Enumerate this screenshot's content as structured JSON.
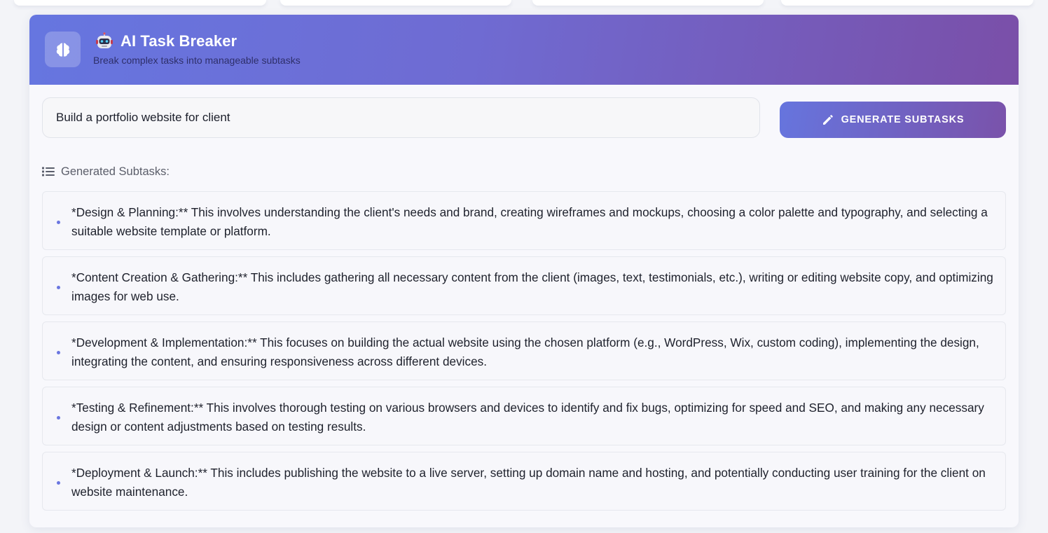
{
  "header": {
    "title": "AI Task Breaker",
    "subtitle": "Break complex tasks into manageable subtasks",
    "gradient": [
      "#6676e0",
      "#7a4fa8"
    ]
  },
  "task_input": {
    "value": "Build a portfolio website for client"
  },
  "generate_button": {
    "label": "GENERATE SUBTASKS",
    "icon": "pencil-icon"
  },
  "results": {
    "label": "Generated Subtasks:",
    "icon": "list-icon",
    "subtasks": [
      "*Design & Planning:** This involves understanding the client's needs and brand, creating wireframes and mockups, choosing a color palette and typography, and selecting a suitable website template or platform.",
      "*Content Creation & Gathering:** This includes gathering all necessary content from the client (images, text, testimonials, etc.), writing or editing website copy, and optimizing images for web use.",
      "*Development & Implementation:** This focuses on building the actual website using the chosen platform (e.g., WordPress, Wix, custom coding), implementing the design, integrating the content, and ensuring responsiveness across different devices.",
      "*Testing & Refinement:** This involves thorough testing on various browsers and devices to identify and fix bugs, optimizing for speed and SEO, and making any necessary design or content adjustments based on testing results.",
      "*Deployment & Launch:** This includes publishing the website to a live server, setting up domain name and hosting, and potentially conducting user training for the client on website maintenance."
    ]
  },
  "colors": {
    "accent": "#6a76e0",
    "accent_dark": "#7a52aa",
    "card_bg": "#f8f8fc"
  }
}
